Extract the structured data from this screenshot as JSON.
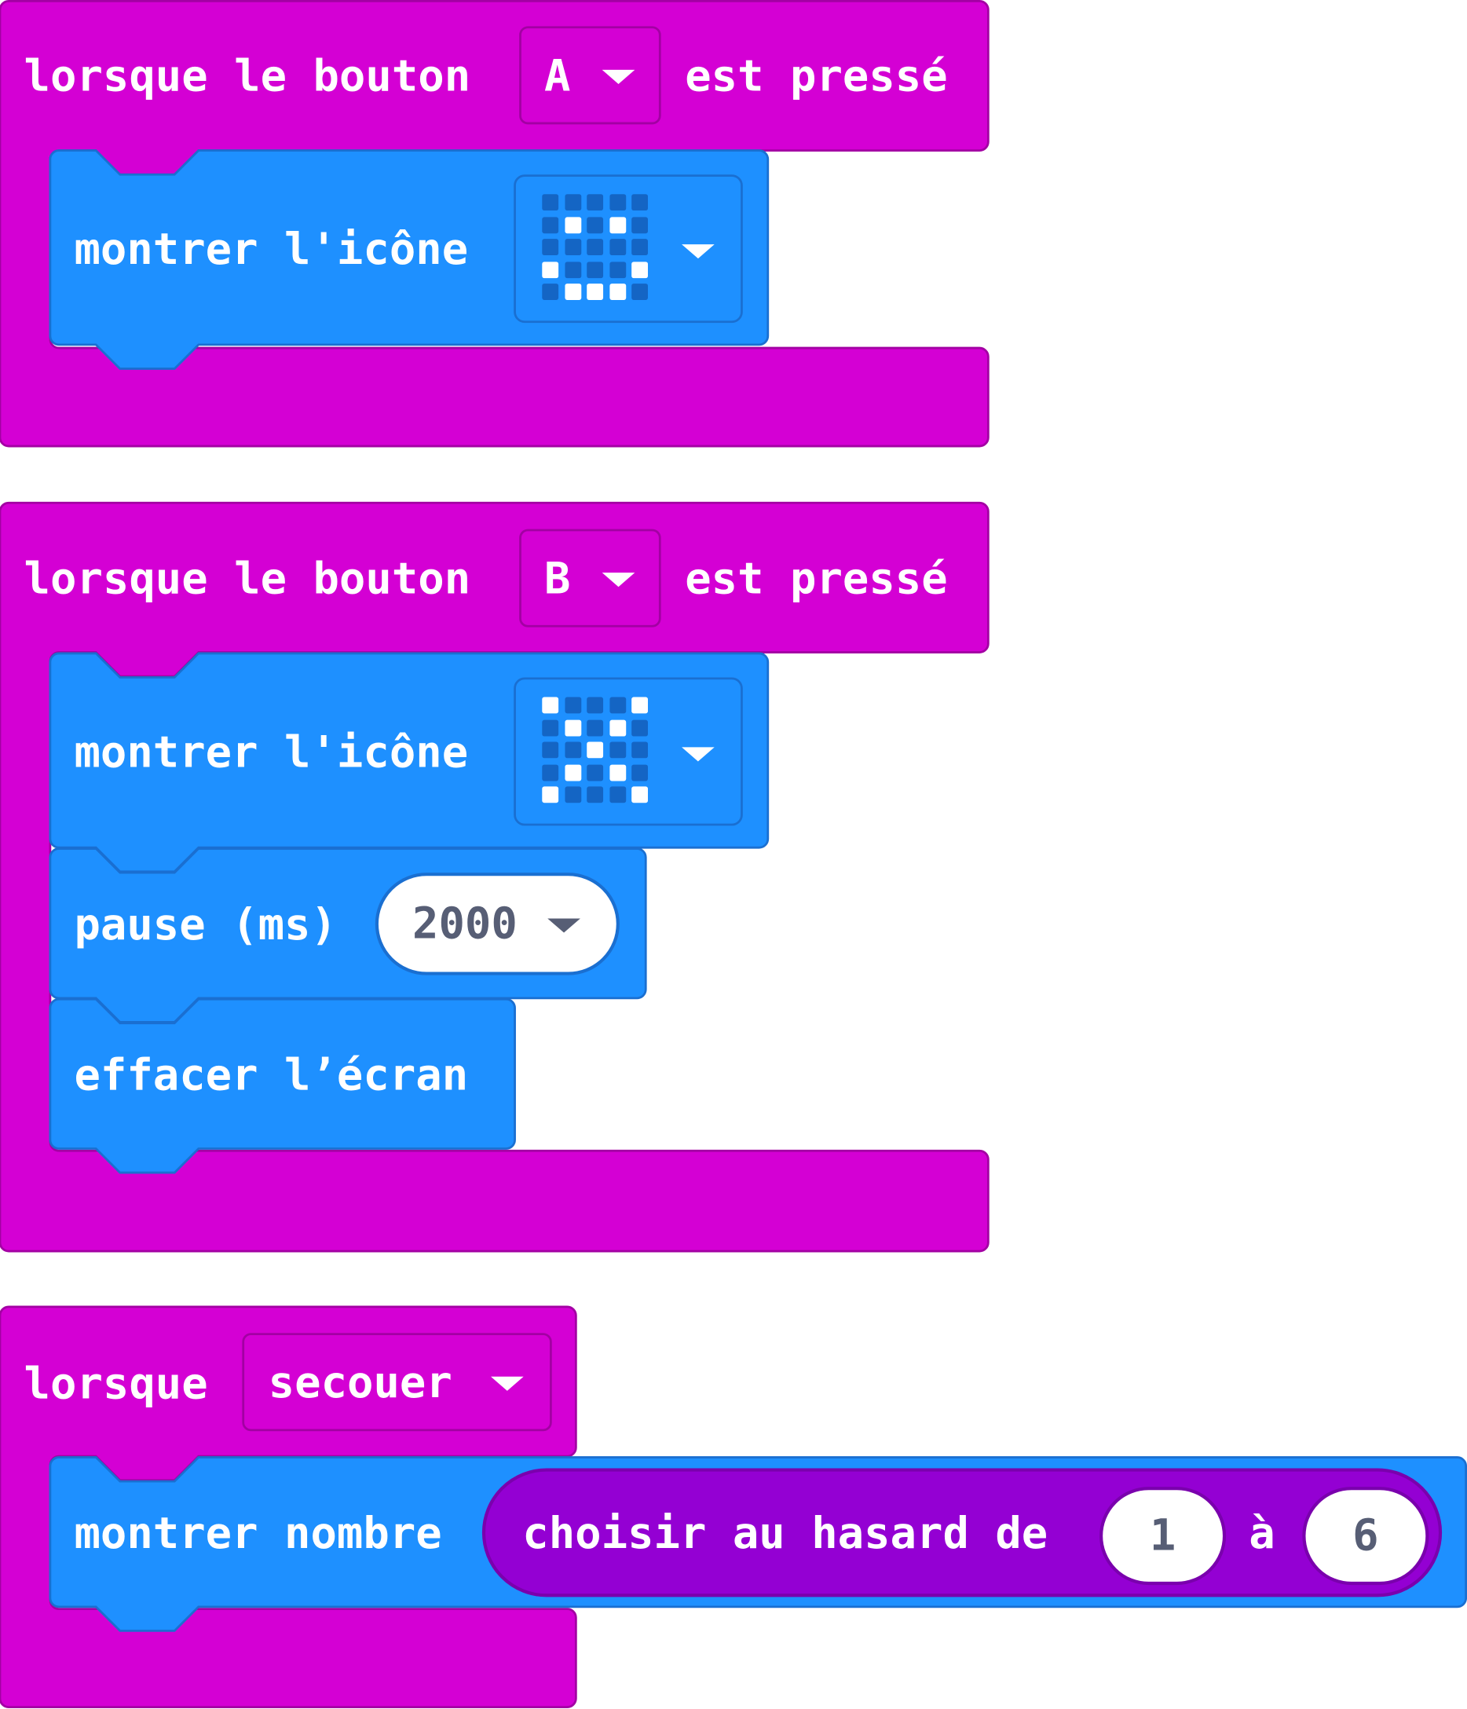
{
  "colors": {
    "event_block": "#d400d4",
    "event_border": "#a300a3",
    "basic_block": "#1e90ff",
    "basic_border": "#1a6fd1",
    "math_reporter": "#9400d3",
    "field_text": "#575e75"
  },
  "event_a": {
    "label_prefix": "lorsque le bouton",
    "button_value": "A",
    "label_suffix": "est pressé",
    "show_icon": {
      "label": "montrer l'icône",
      "leds": [
        [
          0,
          0,
          0,
          0,
          0
        ],
        [
          0,
          1,
          0,
          1,
          0
        ],
        [
          0,
          0,
          0,
          0,
          0
        ],
        [
          1,
          0,
          0,
          0,
          1
        ],
        [
          0,
          1,
          1,
          1,
          0
        ]
      ]
    }
  },
  "event_b": {
    "label_prefix": "lorsque le bouton",
    "button_value": "B",
    "label_suffix": "est pressé",
    "show_icon": {
      "label": "montrer l'icône",
      "leds": [
        [
          1,
          0,
          0,
          0,
          1
        ],
        [
          0,
          1,
          0,
          1,
          0
        ],
        [
          0,
          0,
          1,
          0,
          0
        ],
        [
          0,
          1,
          0,
          1,
          0
        ],
        [
          1,
          0,
          0,
          0,
          1
        ]
      ]
    },
    "pause": {
      "label": "pause (ms)",
      "value": "2000"
    },
    "clear": {
      "label": "effacer l’écran"
    }
  },
  "event_shake": {
    "label": "lorsque",
    "gesture_value": "secouer",
    "show_number": {
      "label": "montrer nombre",
      "random": {
        "label_from": "choisir au hasard de",
        "from": "1",
        "label_to": "à",
        "to": "6"
      }
    }
  },
  "icons": {
    "dropdown": "caret-down-icon"
  }
}
